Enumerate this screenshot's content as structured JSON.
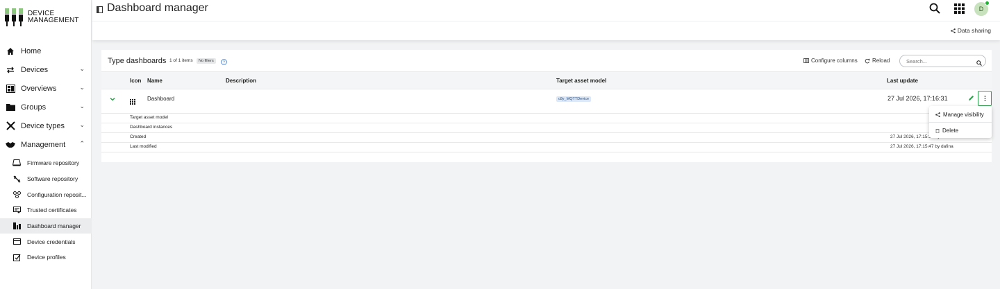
{
  "brand": {
    "line1": "DEVICE",
    "line2": "MANAGEMENT",
    "accent": "#7fc070"
  },
  "header": {
    "title": "Dashboard manager",
    "avatar_initial": "D",
    "data_sharing_label": "Data sharing"
  },
  "nav": {
    "items": [
      {
        "label": "Home",
        "icon": "home-icon"
      },
      {
        "label": "Devices",
        "icon": "swap-arrows-icon",
        "chevron": "⌄"
      },
      {
        "label": "Overviews",
        "icon": "overviews-icon",
        "chevron": "⌄"
      },
      {
        "label": "Groups",
        "icon": "folder-icon",
        "chevron": "⌄"
      },
      {
        "label": "Device types",
        "icon": "device-types-icon",
        "chevron": "⌄"
      },
      {
        "label": "Management",
        "icon": "handshake-icon",
        "chevron": "⌃"
      }
    ],
    "subitems": [
      {
        "label": "Firmware repository",
        "icon": "firmware-icon"
      },
      {
        "label": "Software repository",
        "icon": "software-icon"
      },
      {
        "label": "Configuration reposit...",
        "icon": "configuration-icon"
      },
      {
        "label": "Trusted certificates",
        "icon": "certificate-icon"
      },
      {
        "label": "Dashboard manager",
        "icon": "dashboard-manager-icon"
      },
      {
        "label": "Device credentials",
        "icon": "credential-card-icon"
      },
      {
        "label": "Device profiles",
        "icon": "device-profile-icon"
      }
    ]
  },
  "card": {
    "title": "Type dashboards",
    "item_count": "1 of 1 items",
    "filter_badge": "No filters",
    "configure_columns_label": "Configure columns",
    "reload_label": "Reload",
    "search_placeholder": "Search..."
  },
  "table": {
    "headers": {
      "icon": "Icon",
      "name": "Name",
      "description": "Description",
      "target": "Target asset model",
      "last_update": "Last update"
    },
    "row": {
      "name": "Dashboard",
      "description": "",
      "target_asset_model": "c8y_MQTTDevice",
      "last_update": "27 Jul 2026, 17:16:31"
    },
    "details": [
      {
        "label": "Target asset model",
        "value": ""
      },
      {
        "label": "Dashboard instances",
        "value": ""
      },
      {
        "label": "Created",
        "value": "27 Jul 2026, 17:15:14 by dafina"
      },
      {
        "label": "Last modified",
        "value": "27 Jul 2026, 17:15:47 by dafina"
      }
    ]
  },
  "menu": {
    "manage_visibility_label": "Manage visibility",
    "delete_label": "Delete"
  },
  "colors": {
    "accent_green": "#1a9e3a",
    "sidebar_active_bg": "#eaecee",
    "tag_bg": "#dce8f7"
  }
}
